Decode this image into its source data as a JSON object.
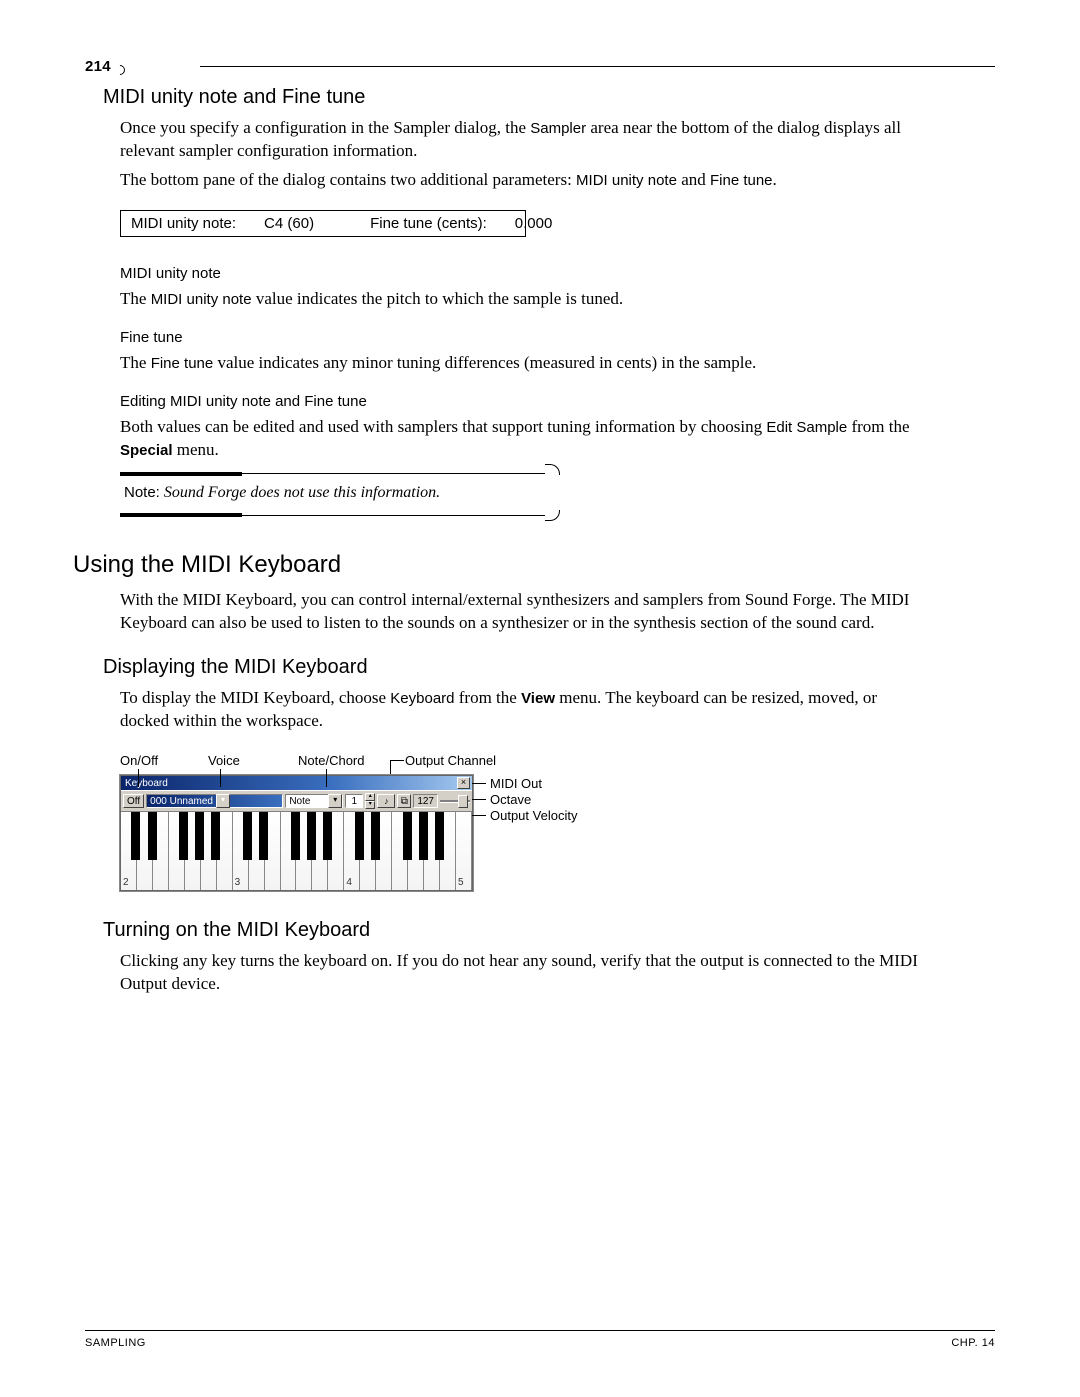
{
  "pageNumber": "214",
  "sections": {
    "midiUnityFine": {
      "heading": "MIDI unity note and Fine tune",
      "para1_a": "Once you specify a configuration in the Sampler dialog, the ",
      "para1_b": "Sampler",
      "para1_c": " area near the bottom of the dialog displays all relevant sampler configuration information.",
      "para2_a": "The bottom pane of the dialog contains two additional parameters: ",
      "para2_b": "MIDI unity note",
      "para2_c": " and ",
      "para2_d": "Fine tune",
      "para2_e": "."
    },
    "midiParamsFig": {
      "label1": "MIDI unity note:",
      "value1": "C4 (60)",
      "label2": "Fine tune (cents):",
      "value2": "0.000"
    },
    "midiUnityNote": {
      "heading": "MIDI unity note",
      "para_a": "The ",
      "para_b": "MIDI unity note",
      "para_c": " value indicates the pitch to which the sample is tuned."
    },
    "fineTune": {
      "heading": "Fine tune",
      "para_a": "The ",
      "para_b": "Fine tune",
      "para_c": " value indicates any minor tuning differences (measured in cents) in the sample."
    },
    "editing": {
      "heading": "Editing MIDI unity note and Fine tune",
      "para_a": "Both values can be edited and used with samplers that support tuning information by choosing ",
      "para_b": "Edit Sample",
      "para_c": " from the ",
      "para_d": "Special",
      "para_e": " menu."
    },
    "note": {
      "label": "Note:",
      "text": " Sound Forge does not use this information."
    },
    "usingKb": {
      "heading": "Using the MIDI Keyboard",
      "para": "With the MIDI Keyboard, you can control internal/external synthesizers and samplers from Sound Forge. The MIDI Keyboard can also be used to listen to the sounds on a synthesizer or in the synthesis section of the sound card."
    },
    "displayKb": {
      "heading": "Displaying the MIDI Keyboard",
      "para_a": "To display the MIDI Keyboard, choose ",
      "para_b": "Keyboard",
      "para_c": " from the ",
      "para_d": "View",
      "para_e": " menu. The keyboard can be resized, moved, or docked within the workspace."
    },
    "kbFigLabels": {
      "onoff": "On/Off",
      "voice": "Voice",
      "notechord": "Note/Chord",
      "outchannel": "Output Channel",
      "midiout": "MIDI Out",
      "octave": "Octave",
      "outvel": "Output Velocity"
    },
    "kbWindow": {
      "title": "Keyboard",
      "offBtn": "Off",
      "voiceNum": "000",
      "voiceName": "Unnamed",
      "noteLabel": "Note",
      "channel": "1",
      "velVal": "127",
      "octaveLabels": [
        "2",
        "3",
        "4",
        "5"
      ]
    },
    "turnOn": {
      "heading": "Turning on the MIDI Keyboard",
      "para": "Clicking any key turns the keyboard on. If you do not hear any sound, verify that the output is connected to the MIDI Output device."
    }
  },
  "footer": {
    "left": "SAMPLING",
    "right": "CHP. 14"
  }
}
